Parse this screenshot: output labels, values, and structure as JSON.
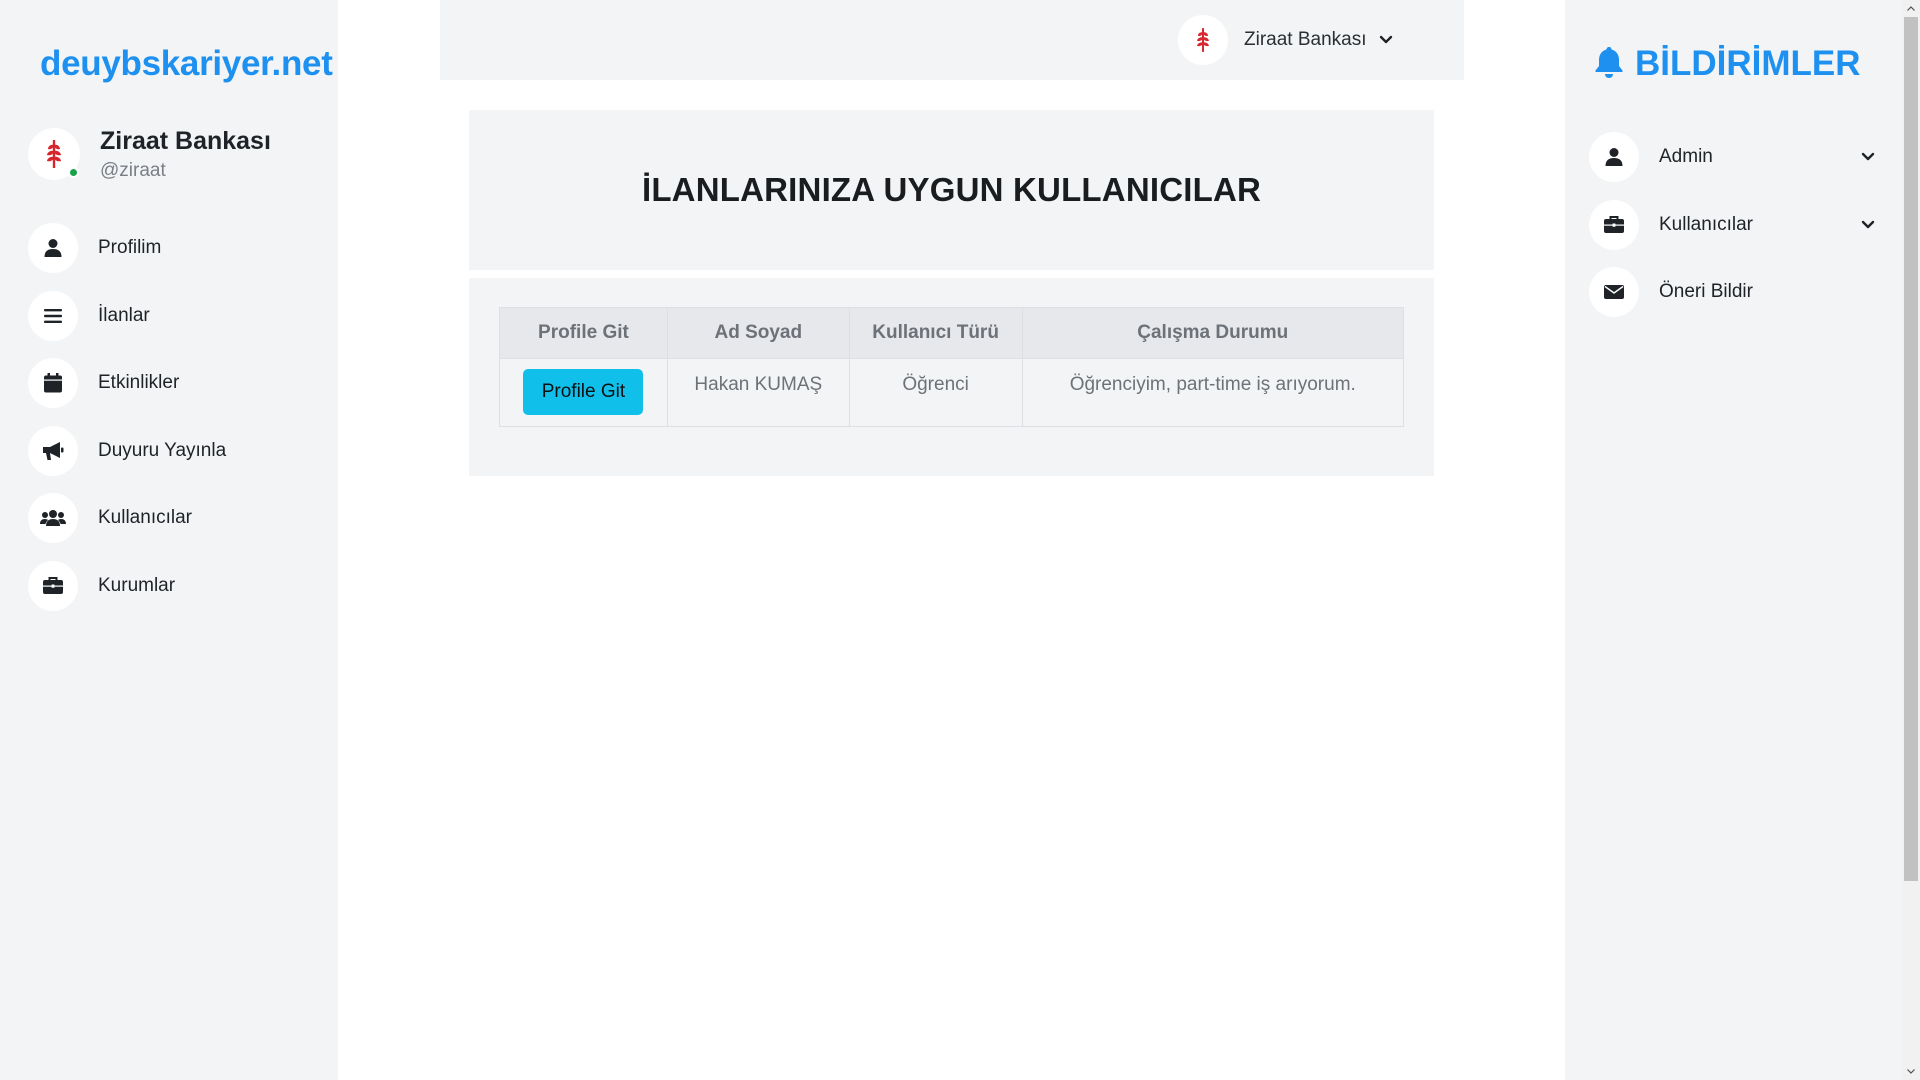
{
  "brand": "deuybskariyer.net",
  "profile": {
    "name": "Ziraat Bankası",
    "handle": "@ziraat",
    "status_color": "#16a34a"
  },
  "sidebar": {
    "items": [
      {
        "label": "Profilim",
        "icon": "user-icon"
      },
      {
        "label": "İlanlar",
        "icon": "list-icon"
      },
      {
        "label": "Etkinlikler",
        "icon": "calendar-icon"
      },
      {
        "label": "Duyuru Yayınla",
        "icon": "megaphone-icon"
      },
      {
        "label": "Kullanıcılar",
        "icon": "users-icon"
      },
      {
        "label": "Kurumlar",
        "icon": "briefcase-icon"
      }
    ]
  },
  "topbar": {
    "org_name": "Ziraat Bankası",
    "org_logo": "ziraat-wheat-logo"
  },
  "main": {
    "title": "İLANLARINIZA UYGUN KULLANICILAR",
    "table": {
      "headers": [
        "Profile Git",
        "Ad Soyad",
        "Kullanıcı Türü",
        "Çalışma Durumu"
      ],
      "rows": [
        {
          "button_label": "Profile Git",
          "name": "Hakan KUMAŞ",
          "type": "Öğrenci",
          "status": "Öğrenciyim, part-time iş arıyorum."
        }
      ]
    }
  },
  "notifications": {
    "title": "BİLDİRİMLER",
    "items": [
      {
        "label": "Admin",
        "icon": "user-icon",
        "has_chevron": true
      },
      {
        "label": "Kullanıcılar",
        "icon": "briefcase-icon",
        "has_chevron": true
      },
      {
        "label": "Öneri Bildir",
        "icon": "envelope-icon",
        "has_chevron": false
      }
    ]
  },
  "colors": {
    "accent": "#1e90ef",
    "button": "#10c0ea",
    "panel_bg": "#f2f4f6",
    "logo_red": "#d7262e"
  }
}
